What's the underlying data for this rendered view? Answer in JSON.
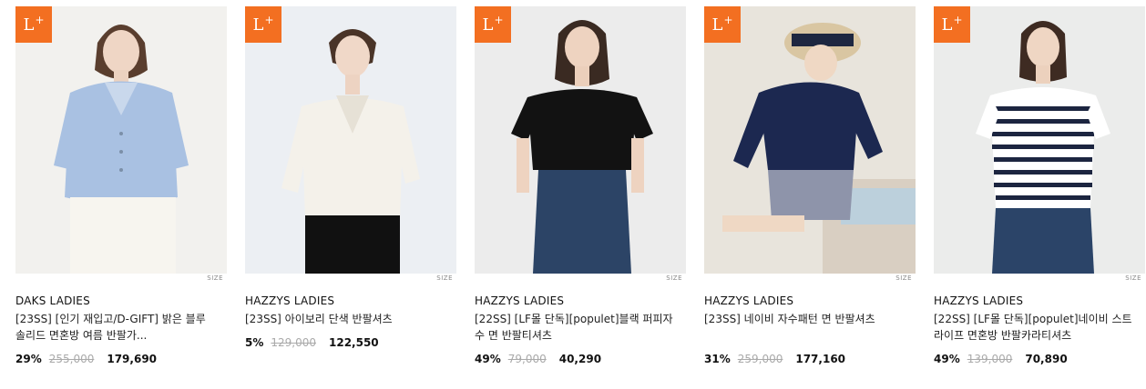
{
  "badge": {
    "main": "L",
    "sup": "+"
  },
  "size_label": "SIZE",
  "products": [
    {
      "brand": "DAKS LADIES",
      "title": "[23SS] [인기 재입고/D-GIFT] 밝은 블루 솔리드 면혼방 여름 반팔가...",
      "discount": "29%",
      "original_price": "255,000",
      "price": "179,690",
      "photo": "model-light-blue-knit-cardigan"
    },
    {
      "brand": "HAZZYS LADIES",
      "title": "[23SS] 아이보리 단색 반팔셔츠",
      "discount": "5%",
      "original_price": "129,000",
      "price": "122,550",
      "photo": "model-ivory-shirt"
    },
    {
      "brand": "HAZZYS LADIES",
      "title": "[22SS] [LF몰 단독][populet]블랙 퍼피자수 면 반팔티셔츠",
      "discount": "49%",
      "original_price": "79,000",
      "price": "40,290",
      "photo": "model-black-tshirt"
    },
    {
      "brand": "HAZZYS LADIES",
      "title": "[23SS] 네이비 자수패턴 면 반팔셔츠",
      "discount": "31%",
      "original_price": "259,000",
      "price": "177,160",
      "photo": "model-navy-eyelet-shirt"
    },
    {
      "brand": "HAZZYS LADIES",
      "title": "[22SS] [LF몰 단독][populet]네이비 스트라이프 면혼방 반팔카라티셔츠",
      "discount": "49%",
      "original_price": "139,000",
      "price": "70,890",
      "photo": "model-striped-polo"
    }
  ],
  "colors": {
    "badge": "#f36f21",
    "strike": "#aaaaaa"
  }
}
